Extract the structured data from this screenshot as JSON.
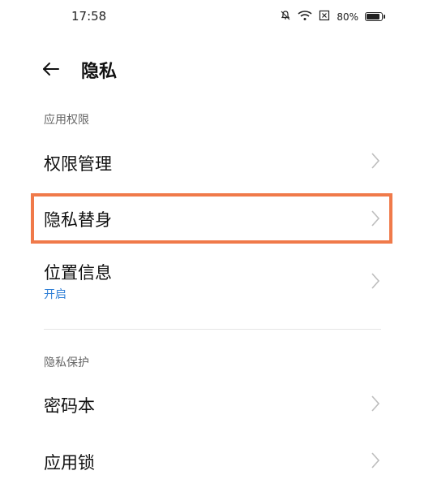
{
  "status_bar": {
    "time": "17:58",
    "battery_text": "80%",
    "icons": [
      "silent-bell-icon",
      "wifi-icon",
      "sim-off-icon",
      "battery-icon"
    ]
  },
  "header": {
    "title": "隐私",
    "back_icon": "arrow-left-icon"
  },
  "sections": {
    "app_permissions": {
      "label": "应用权限",
      "items": [
        {
          "label": "权限管理"
        },
        {
          "label": "隐私替身"
        },
        {
          "label": "位置信息",
          "sub": "开启"
        }
      ]
    },
    "privacy_protection": {
      "label": "隐私保护",
      "items": [
        {
          "label": "密码本"
        },
        {
          "label": "应用锁"
        }
      ]
    }
  },
  "colors": {
    "highlight_border": "#f07a4a",
    "sub_text_blue": "#2f7fd6",
    "chevron": "#bdbdbd"
  }
}
